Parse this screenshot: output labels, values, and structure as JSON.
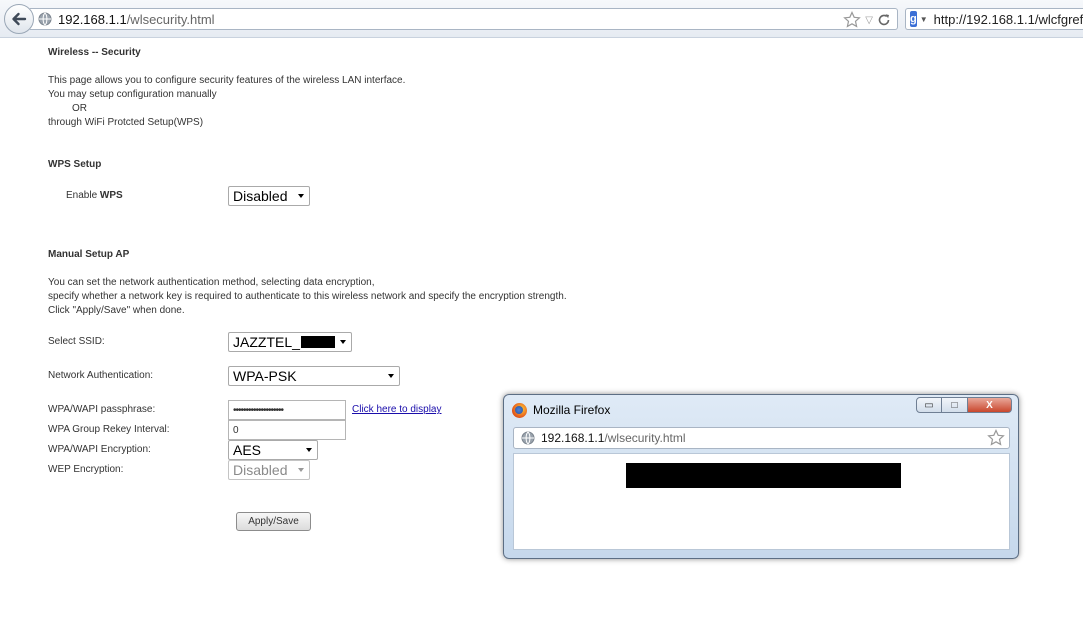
{
  "browser": {
    "url_host": "192.168.1.1",
    "url_path": "/wlsecurity.html",
    "search_text": "http://192.168.1.1/wlcfgrefr"
  },
  "page": {
    "title": "Wireless -- Security",
    "intro": [
      "This page allows you to configure security features of the wireless LAN interface.",
      "You may setup configuration manually",
      "OR",
      "through WiFi Protcted Setup(WPS)"
    ],
    "wps": {
      "heading": "WPS Setup",
      "enable_label_prefix": "Enable ",
      "enable_label_bold": "WPS",
      "value": "Disabled"
    },
    "manual": {
      "heading": "Manual Setup AP",
      "desc": [
        "You can set the network authentication method, selecting data encryption,",
        "specify whether a network key is required to authenticate to this wireless network and specify the encryption strength.",
        "Click \"Apply/Save\" when done."
      ],
      "ssid_label": "Select SSID:",
      "ssid_value": "JAZZTEL_",
      "auth_label": "Network Authentication:",
      "auth_value": "WPA-PSK",
      "passphrase_label": "WPA/WAPI passphrase:",
      "passphrase_value": "••••••••••••••••••••",
      "display_link": "Click here to display",
      "rekey_label": "WPA Group Rekey Interval:",
      "rekey_value": "0",
      "encryption_label": "WPA/WAPI Encryption:",
      "encryption_value": "AES",
      "wep_label": "WEP Encryption:",
      "wep_value": "Disabled",
      "apply_label": "Apply/Save"
    }
  },
  "popup": {
    "title": "Mozilla Firefox",
    "url_host": "192.168.1.1",
    "url_path": "/wlsecurity.html",
    "minimize": "▭",
    "maximize": "□",
    "close": "X"
  }
}
